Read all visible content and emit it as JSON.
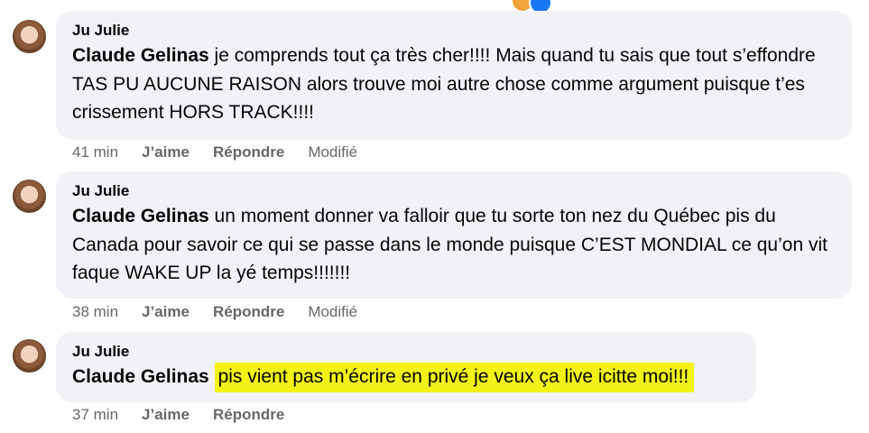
{
  "comments": [
    {
      "author": "Ju Julie",
      "mention": "Claude Gelinas",
      "text": " je comprends tout ça très cher!!!! Mais quand tu sais que tout s’effondre TAS PU AUCUNE RAISON alors trouve moi autre chose comme argument puisque t’es crissement HORS TRACK!!!!",
      "time": "41 min",
      "like": "J’aime",
      "reply": "Répondre",
      "edited": "Modifié"
    },
    {
      "author": "Ju Julie",
      "mention": "Claude Gelinas",
      "text": " un moment donner va falloir que tu sorte ton nez du Québec pis du Canada pour savoir ce qui se passe dans le monde puisque C’EST MONDIAL ce qu’on vit faque WAKE UP la yé temps!!!!!!!",
      "time": "38 min",
      "like": "J’aime",
      "reply": "Répondre",
      "edited": "Modifié"
    },
    {
      "author": "Ju Julie",
      "mention": "Claude Gelinas",
      "text": "pis vient pas m’écrire en privé je veux ça live icitte moi!!!",
      "time": "37 min",
      "like": "J’aime",
      "reply": "Répondre"
    }
  ],
  "colors": {
    "bubble": "#f0f2f5",
    "highlight": "#f2f216",
    "meta": "#65676b"
  }
}
